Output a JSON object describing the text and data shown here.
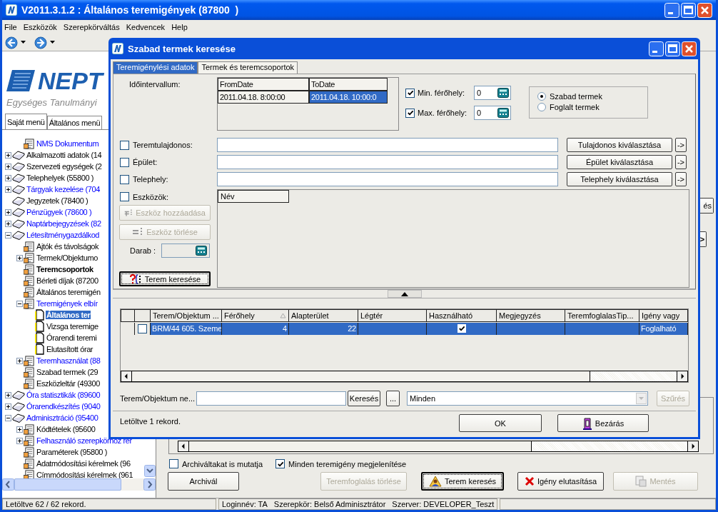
{
  "window": {
    "title": "V2011.3.1.2 : Általános teremigények (87800  )"
  },
  "menu": [
    "File",
    "Eszközök",
    "Szerepkörváltás",
    "Kedvencek",
    "Help"
  ],
  "logo": {
    "name": "NEPT",
    "tagline": "Egységes Tanulmányi"
  },
  "sidebar": {
    "tabs": [
      {
        "label": "Saját menü",
        "selected": true
      },
      {
        "label": "Általános menü",
        "selected": false
      }
    ],
    "tree": {
      "partial_branch": [
        {
          "label": "NMS Dokumentum",
          "kind": "form",
          "accent": true,
          "bold": false,
          "selected": false
        }
      ],
      "items": [
        {
          "label": "Alkalmazotti adatok (14",
          "kind": "book",
          "accent": false,
          "bold": false,
          "selected": false,
          "expanded": false
        },
        {
          "label": "Szervezeti egységek (2",
          "kind": "book",
          "accent": false,
          "bold": false,
          "selected": false,
          "expanded": false
        },
        {
          "label": "Telephelyek (55800  )",
          "kind": "book",
          "accent": false,
          "bold": false,
          "selected": false,
          "expanded": false
        },
        {
          "label": "Tárgyak kezelése (704",
          "kind": "book",
          "accent": true,
          "bold": false,
          "selected": false,
          "expanded": false
        },
        {
          "label": "Jegyzetek (78400  )",
          "kind": "book",
          "accent": false,
          "bold": false,
          "selected": false
        },
        {
          "label": "Pénzügyek (78600  )",
          "kind": "book",
          "accent": true,
          "bold": false,
          "selected": false,
          "expanded": false
        },
        {
          "label": "Naptárbejegyzések (82",
          "kind": "book",
          "accent": true,
          "bold": false,
          "selected": false,
          "expanded": false
        },
        {
          "label": "Létesítménygazdálkod",
          "kind": "book",
          "accent": true,
          "bold": false,
          "selected": false,
          "expanded": true,
          "children": [
            {
              "label": "Ajtók és távolságok",
              "kind": "form",
              "accent": false,
              "bold": false,
              "selected": false
            },
            {
              "label": "Termek/Objektumo",
              "kind": "form",
              "accent": false,
              "bold": false,
              "selected": false,
              "expanded": false
            },
            {
              "label": "Teremcsoportok",
              "kind": "form",
              "accent": false,
              "bold": true,
              "selected": false
            },
            {
              "label": "Bérleti díjak (87200",
              "kind": "form",
              "accent": false,
              "bold": false,
              "selected": false
            },
            {
              "label": "Általános teremigén",
              "kind": "form",
              "accent": false,
              "bold": false,
              "selected": false
            },
            {
              "label": "Teremigények elbír",
              "kind": "form",
              "accent": true,
              "bold": false,
              "selected": false,
              "expanded": true,
              "children": [
                {
                  "label": "Általános ter",
                  "kind": "page",
                  "accent": false,
                  "bold": true,
                  "selected": true
                },
                {
                  "label": "Vizsga teremige",
                  "kind": "page",
                  "accent": false,
                  "bold": false,
                  "selected": false
                },
                {
                  "label": "Órarendi teremi",
                  "kind": "page",
                  "accent": false,
                  "bold": false,
                  "selected": false
                },
                {
                  "label": "Elutasított órar",
                  "kind": "page",
                  "accent": false,
                  "bold": false,
                  "selected": false
                }
              ]
            },
            {
              "label": "Teremhasználat (88",
              "kind": "form",
              "accent": true,
              "bold": false,
              "selected": false,
              "expanded": false
            },
            {
              "label": "Szabad termek (29",
              "kind": "form",
              "accent": false,
              "bold": false,
              "selected": false
            },
            {
              "label": "Eszközleltár (49300",
              "kind": "form",
              "accent": false,
              "bold": false,
              "selected": false
            }
          ]
        },
        {
          "label": "Óra statisztikák (89600",
          "kind": "book",
          "accent": true,
          "bold": false,
          "selected": false,
          "expanded": false
        },
        {
          "label": "Órarendkészítés (9040",
          "kind": "book",
          "accent": true,
          "bold": false,
          "selected": false,
          "expanded": false
        },
        {
          "label": "Adminisztráció (95400",
          "kind": "book",
          "accent": true,
          "bold": false,
          "selected": false,
          "expanded": true,
          "children": [
            {
              "label": "Kódtételek (95600",
              "kind": "form",
              "accent": false,
              "bold": false,
              "selected": false,
              "expanded": false
            },
            {
              "label": "Felhasználó szerepkörhoz rer",
              "kind": "form",
              "accent": true,
              "bold": false,
              "selected": false,
              "expanded": false
            },
            {
              "label": "Paraméterek (95800  )",
              "kind": "form",
              "accent": false,
              "bold": false,
              "selected": false
            },
            {
              "label": "Adatmódosítási kérelmek (96",
              "kind": "form",
              "accent": false,
              "bold": false,
              "selected": false
            },
            {
              "label": "Címmódosítási kérelmek (961",
              "kind": "form",
              "accent": false,
              "bold": false,
              "selected": false
            }
          ]
        }
      ]
    }
  },
  "main": {
    "edge_buttons": [
      "és",
      ">"
    ],
    "options": [
      {
        "label": "Archiváltakat is mutatja",
        "checked": false
      },
      {
        "label": "Minden teremigény megjelenítése",
        "checked": true
      }
    ],
    "buttons": [
      {
        "label": "Archivál",
        "disabled": false,
        "default": false
      },
      {
        "label": "Teremfoglalás törlése",
        "disabled": true,
        "default": false
      },
      {
        "label": "Terem keresés",
        "disabled": false,
        "default": true
      },
      {
        "label": "Igény elutasítása",
        "disabled": false,
        "default": false
      },
      {
        "label": "Mentés",
        "disabled": true,
        "default": false
      }
    ]
  },
  "status_bar": {
    "record_count": "Letöltve 62 / 62 rekord.",
    "info": [
      "Loginnév: TA",
      "Szerepkör: Belső Adminisztrátor",
      "Szerver: DEVELOPER_Teszt"
    ]
  },
  "dialog": {
    "title": "Szabad termek keresése",
    "tabs": [
      {
        "label": "Teremigénylési adatok",
        "selected": true
      },
      {
        "label": "Termek és teremcsoportok",
        "selected": false
      }
    ],
    "interval": {
      "label": "Időintervallum:",
      "columns": [
        "FromDate",
        "ToDate"
      ],
      "cells": [
        {
          "value": "2011.04.18. 8:00:00",
          "selected": false
        },
        {
          "value": "2011.04.18. 10:00:0",
          "selected": true
        }
      ]
    },
    "capacity": [
      {
        "label": "Min. férőhely:",
        "checked": true,
        "value": "0"
      },
      {
        "label": "Max. férőhely:",
        "checked": true,
        "value": "0"
      }
    ],
    "room_state": [
      {
        "label": "Szabad termek",
        "selected": true
      },
      {
        "label": "Foglalt termek",
        "selected": false
      }
    ],
    "filters": [
      {
        "label": "Teremtulajdonos:",
        "checked": false,
        "button": "Tulajdonos kiválasztása",
        "arrow": "->"
      },
      {
        "label": "Épület:",
        "checked": false,
        "button": "Épület kiválasztása",
        "arrow": "->"
      },
      {
        "label": "Telephely:",
        "checked": false,
        "button": "Telephely kiválasztása",
        "arrow": "->"
      }
    ],
    "equipment": {
      "label": "Eszközök:",
      "checked": false,
      "column": "Név",
      "add_button": {
        "label": "Eszköz hozzáadása",
        "disabled": true
      },
      "remove_button": {
        "label": "Eszköz törlése",
        "disabled": true
      },
      "count_label": "Darab :"
    },
    "search_button": "Terem keresése",
    "results": {
      "columns": [
        {
          "label": "Terem/Objektum ...",
          "kind": "text",
          "sorted": false
        },
        {
          "label": "Férőhely",
          "kind": "number",
          "sorted": true
        },
        {
          "label": "Alapterület",
          "kind": "number",
          "sorted": false
        },
        {
          "label": "Légtér",
          "kind": "number",
          "sorted": false
        },
        {
          "label": "Használható",
          "kind": "check",
          "sorted": false
        },
        {
          "label": "Megjegyzés",
          "kind": "text",
          "sorted": false
        },
        {
          "label": "TeremfoglalasTip...",
          "kind": "text",
          "sorted": false
        },
        {
          "label": "Igény vagy",
          "kind": "text",
          "sorted": false
        }
      ],
      "rows": [
        {
          "selected": true,
          "checked": false,
          "room": "BRM/44 605. Szeme",
          "capacity": "4",
          "area": "22",
          "usable": true,
          "request": "Foglalható"
        }
      ]
    },
    "search_bar": {
      "label": "Terem/Objektum ne...",
      "button": "Keresés",
      "more": "...",
      "combo": "Minden",
      "filter_button": {
        "label": "Szűrés",
        "disabled": true
      }
    },
    "record_count": "Letöltve 1 rekord.",
    "ok": "OK",
    "close": "Bezárás"
  }
}
